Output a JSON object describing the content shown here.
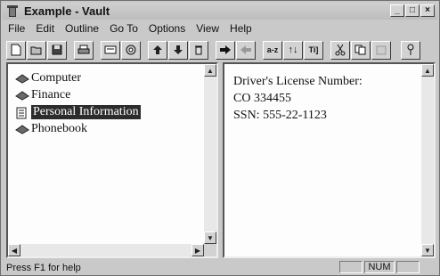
{
  "window": {
    "title": "Example - Vault",
    "minimize": "_",
    "maximize": "□",
    "close": "×"
  },
  "menu": [
    {
      "label": "File"
    },
    {
      "label": "Edit"
    },
    {
      "label": "Outline"
    },
    {
      "label": "Go To"
    },
    {
      "label": "Options"
    },
    {
      "label": "View"
    },
    {
      "label": "Help"
    }
  ],
  "toolbar": {
    "sort_az": "a-z",
    "sort_updown": "↑↓",
    "title_btn": "Ti]"
  },
  "tree": {
    "items": [
      {
        "label": "Computer",
        "icon": "book-icon",
        "selected": false
      },
      {
        "label": "Finance",
        "icon": "book-icon",
        "selected": false
      },
      {
        "label": "Personal Information",
        "icon": "page-icon",
        "selected": true
      },
      {
        "label": "Phonebook",
        "icon": "book-icon",
        "selected": false
      }
    ]
  },
  "note": {
    "lines": [
      "Driver's License Number:",
      "CO 334455",
      "SSN: 555-22-1123"
    ]
  },
  "status": {
    "help": "Press F1 for help",
    "num": "NUM"
  }
}
